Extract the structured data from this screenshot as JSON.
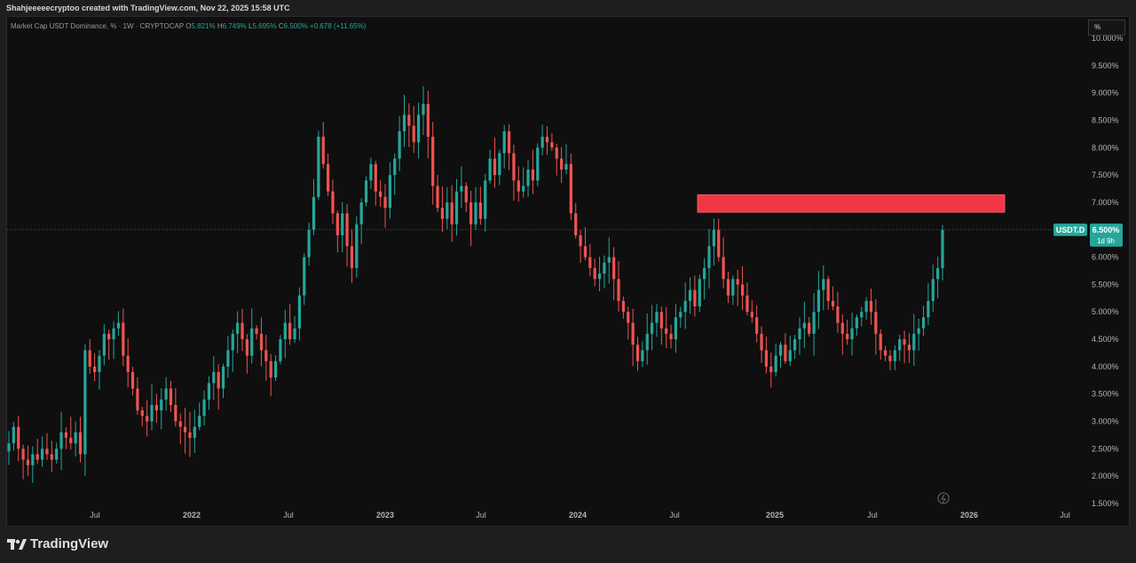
{
  "header": {
    "caption": "Shahjeeeeecryptoo created with TradingView.com, Nov 22, 2025 15:58 UTC"
  },
  "legend": {
    "symbol": "Market Cap USDT Dominance, % · 1W · CRYPTOCAP",
    "o_label": "O",
    "o_value": "5.821%",
    "h_label": "H",
    "h_value": "6.749%",
    "l_label": "L",
    "l_value": "5.695%",
    "c_label": "C",
    "c_value": "6.500%",
    "change": "+0.678 (+11.65%)"
  },
  "scale_button": {
    "label": "%"
  },
  "price_tag": {
    "symbol": "USDT.D",
    "value": "6.500%",
    "countdown": "1d 9h"
  },
  "branding": {
    "logo_text": "TradingView"
  },
  "colors": {
    "up": "#26a69a",
    "down": "#ef5350",
    "zone": "#f23645",
    "background": "#0f0f0f",
    "axis_text": "#b2b5be"
  },
  "chart_data": {
    "type": "candlestick",
    "title": "Market Cap USDT Dominance, % · 1W · CRYPTOCAP",
    "y_ticks": [
      "10.000%",
      "9.500%",
      "9.000%",
      "8.500%",
      "8.000%",
      "7.500%",
      "7.000%",
      "6.500%",
      "6.000%",
      "5.500%",
      "5.000%",
      "4.500%",
      "4.000%",
      "3.500%",
      "3.000%",
      "2.500%",
      "2.000%",
      "1.500%"
    ],
    "x_ticks": [
      "Jul",
      "2022",
      "Jul",
      "2023",
      "Jul",
      "2024",
      "Jul",
      "2025",
      "Jul",
      "2026",
      "Jul"
    ],
    "ylim": [
      1.5,
      10.0
    ],
    "last_price": 6.5,
    "resistance_zone": {
      "low": 6.82,
      "high": 7.14,
      "from": "2024-08",
      "to": "2026-03"
    },
    "closes": [
      2.6,
      2.9,
      2.5,
      2.3,
      2.2,
      2.4,
      2.3,
      2.5,
      2.4,
      2.3,
      2.5,
      2.8,
      2.7,
      2.6,
      2.8,
      2.4,
      4.3,
      4.0,
      3.9,
      4.2,
      4.6,
      4.5,
      4.7,
      4.8,
      4.2,
      3.9,
      3.6,
      3.2,
      3.1,
      3.0,
      3.3,
      3.2,
      3.4,
      3.6,
      3.3,
      3.0,
      2.9,
      2.8,
      2.7,
      2.9,
      3.1,
      3.4,
      3.7,
      3.9,
      3.6,
      4.0,
      4.3,
      4.6,
      4.8,
      4.5,
      4.2,
      4.7,
      4.6,
      4.3,
      4.1,
      3.8,
      4.1,
      4.5,
      4.8,
      4.5,
      4.7,
      5.3,
      6.0,
      6.5,
      7.1,
      8.2,
      7.7,
      7.2,
      6.8,
      6.4,
      6.8,
      6.2,
      5.8,
      6.6,
      7.0,
      7.4,
      7.7,
      7.2,
      7.1,
      6.9,
      7.5,
      7.8,
      8.3,
      8.6,
      8.4,
      8.1,
      8.6,
      8.8,
      8.2,
      7.3,
      6.9,
      6.7,
      7.0,
      6.6,
      7.2,
      7.3,
      7.0,
      6.6,
      7.0,
      6.7,
      7.4,
      7.8,
      7.5,
      7.9,
      8.3,
      7.9,
      7.4,
      7.2,
      7.3,
      7.6,
      7.4,
      8.0,
      8.2,
      8.1,
      8.0,
      7.8,
      7.6,
      7.7,
      6.8,
      6.4,
      6.2,
      6.0,
      5.8,
      5.6,
      5.7,
      5.9,
      6.0,
      5.6,
      5.2,
      5.0,
      4.8,
      4.4,
      4.1,
      4.3,
      4.6,
      4.8,
      5.0,
      4.7,
      4.6,
      4.5,
      4.9,
      5.0,
      5.2,
      5.4,
      5.1,
      5.6,
      5.8,
      6.2,
      6.5,
      6.0,
      5.6,
      5.3,
      5.6,
      5.5,
      5.3,
      5.0,
      4.9,
      4.6,
      4.3,
      4.0,
      3.9,
      4.2,
      4.4,
      4.1,
      4.3,
      4.5,
      4.7,
      4.8,
      4.6,
      5.0,
      5.4,
      5.6,
      5.2,
      5.1,
      4.8,
      4.6,
      4.5,
      4.7,
      4.9,
      5.0,
      5.2,
      5.0,
      4.6,
      4.3,
      4.2,
      4.1,
      4.3,
      4.5,
      4.4,
      4.3,
      4.6,
      4.7,
      4.9,
      5.2,
      5.6,
      5.8,
      6.5
    ]
  }
}
